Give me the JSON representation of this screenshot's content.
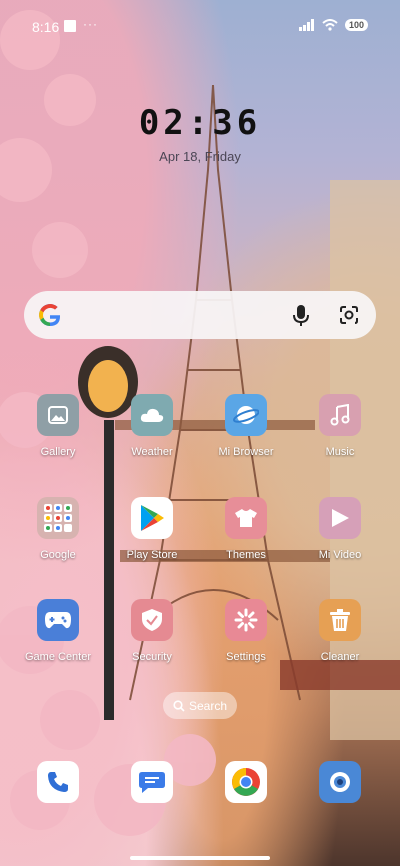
{
  "status": {
    "time": "8:16",
    "more": "···",
    "battery": "100"
  },
  "clock": {
    "time": "02:36",
    "date": "Apr 18, Friday"
  },
  "search": {
    "icons": [
      "google-g-icon",
      "mic-icon",
      "google-lens-icon"
    ]
  },
  "apps": [
    {
      "label": "Gallery",
      "icon": "gallery-icon",
      "color": "#8f9fa6"
    },
    {
      "label": "Weather",
      "icon": "cloud-icon",
      "color": "#7faab0"
    },
    {
      "label": "Mi Browser",
      "icon": "planet-icon",
      "color": "#5aa6e6"
    },
    {
      "label": "Music",
      "icon": "music-note-icon",
      "color": "#d8a0b0"
    },
    {
      "label": "Google",
      "icon": "google-folder-icon",
      "color": "#d7b3b0"
    },
    {
      "label": "Play Store",
      "icon": "play-store-icon",
      "color": "#ffffff"
    },
    {
      "label": "Themes",
      "icon": "shirt-icon",
      "color": "#e78e98"
    },
    {
      "label": "Mi Video",
      "icon": "video-play-icon",
      "color": "#d6a0b8"
    },
    {
      "label": "Game Center",
      "icon": "gamepad-icon",
      "color": "#4a7fd8"
    },
    {
      "label": "Security",
      "icon": "shield-icon",
      "color": "#e58a92"
    },
    {
      "label": "Settings",
      "icon": "gear-icon",
      "color": "#e88995"
    },
    {
      "label": "Cleaner",
      "icon": "trash-icon",
      "color": "#e6a054"
    }
  ],
  "dock": [
    {
      "icon": "phone-icon",
      "color": "#ffffff"
    },
    {
      "icon": "messages-icon",
      "color": "#ffffff"
    },
    {
      "icon": "chrome-icon",
      "color": "#ffffff"
    },
    {
      "icon": "camera-icon",
      "color": "#4a88d6"
    }
  ],
  "search_pill": {
    "label": "Search"
  }
}
